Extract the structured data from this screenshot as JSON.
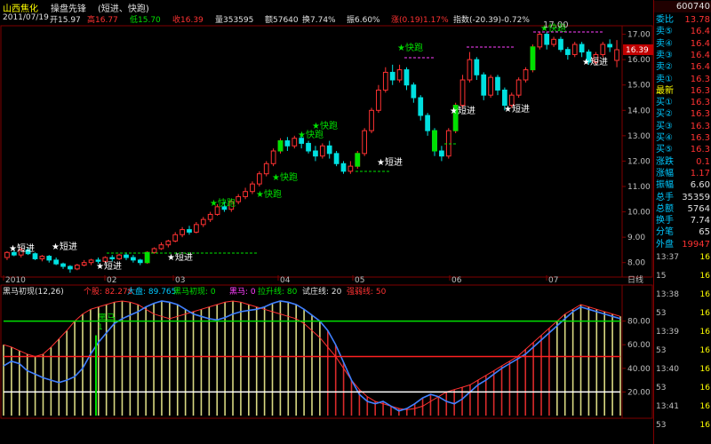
{
  "header": {
    "stock_name": "山西焦化",
    "indicator": "操盘先锋",
    "params": "(短进、快跑)",
    "code": "600740"
  },
  "info": {
    "date": "2011/07/19",
    "open_label": "开15.97",
    "high_label": "高16.77",
    "low_label": "低15.70",
    "close_label": "收16.39",
    "vol_label": "量353595",
    "amt_label": "额57640",
    "turn_label": "换7.74%",
    "amp_label": "振6.60%",
    "chg_label": "涨(0.19)1.17%",
    "index_label": "指数(-20.39)-0.72%"
  },
  "price_axis": [
    "17.00",
    "16.00",
    "15.00",
    "14.00",
    "13.00",
    "12.00",
    "11.00",
    "10.00",
    "9.00",
    "8.00"
  ],
  "price_marker": "16.39",
  "month_labels": [
    "2010",
    "02",
    "03",
    "04",
    "05",
    "06",
    "07"
  ],
  "period_label": "日线",
  "indicator_bar": {
    "name": "黑马初现(12,26)",
    "stock": "个股: 82.278",
    "market": "大盘: 89.765",
    "hm_first": "黑马初现: 0",
    "hm": "黑马: 0",
    "pull": "拉升线: 80",
    "test": "试庄线: 20",
    "strong": "强弱线: 50"
  },
  "ind_axis": [
    "80.00",
    "60.00",
    "40.00",
    "20.00"
  ],
  "ind_tag": "黑马\n1",
  "annotations": {
    "short_in": "短进",
    "quick_run": "快跑",
    "hi_label": "17.00",
    "top_price": "16.39"
  },
  "chart_data": {
    "type": "candlestick",
    "y_range": [
      7.5,
      17.3
    ],
    "ind_range": [
      0,
      100
    ],
    "candles": [
      [
        8.2,
        8.4,
        8.1,
        8.45
      ],
      [
        8.4,
        8.3,
        8.25,
        8.55
      ],
      [
        8.3,
        8.5,
        8.2,
        8.6
      ],
      [
        8.5,
        8.35,
        8.3,
        8.6
      ],
      [
        8.35,
        8.15,
        8.1,
        8.4
      ],
      [
        8.15,
        8.25,
        8.05,
        8.3
      ],
      [
        8.25,
        8.1,
        8.0,
        8.3
      ],
      [
        8.1,
        7.95,
        7.9,
        8.2
      ],
      [
        7.95,
        7.85,
        7.75,
        8.0
      ],
      [
        7.85,
        7.75,
        7.6,
        7.9
      ],
      [
        7.75,
        7.9,
        7.7,
        7.95
      ],
      [
        7.9,
        8.0,
        7.85,
        8.1
      ],
      [
        8.0,
        8.1,
        7.9,
        8.15
      ],
      [
        8.1,
        8.05,
        7.95,
        8.2
      ],
      [
        8.05,
        8.2,
        8.0,
        8.25
      ],
      [
        8.2,
        8.15,
        8.05,
        8.3
      ],
      [
        8.15,
        8.3,
        8.1,
        8.35
      ],
      [
        8.3,
        8.2,
        8.1,
        8.4
      ],
      [
        8.2,
        8.1,
        8.0,
        8.3
      ],
      [
        8.1,
        8.0,
        7.9,
        8.15
      ],
      [
        8.0,
        8.4,
        7.95,
        8.45
      ],
      [
        8.4,
        8.55,
        8.35,
        8.6
      ],
      [
        8.55,
        8.7,
        8.5,
        8.8
      ],
      [
        8.7,
        8.85,
        8.6,
        8.9
      ],
      [
        8.85,
        9.1,
        8.8,
        9.2
      ],
      [
        9.1,
        9.3,
        9.0,
        9.4
      ],
      [
        9.3,
        9.2,
        9.1,
        9.45
      ],
      [
        9.2,
        9.5,
        9.15,
        9.6
      ],
      [
        9.5,
        9.7,
        9.4,
        9.8
      ],
      [
        9.7,
        9.9,
        9.6,
        10.0
      ],
      [
        9.9,
        10.2,
        9.85,
        10.3
      ],
      [
        10.2,
        10.1,
        10.0,
        10.4
      ],
      [
        10.1,
        10.4,
        10.0,
        10.5
      ],
      [
        10.4,
        10.6,
        10.3,
        10.7
      ],
      [
        10.6,
        10.8,
        10.5,
        10.95
      ],
      [
        10.8,
        11.1,
        10.7,
        11.2
      ],
      [
        11.1,
        11.5,
        11.0,
        11.6
      ],
      [
        11.5,
        11.9,
        11.4,
        12.0
      ],
      [
        11.9,
        12.4,
        11.8,
        12.5
      ],
      [
        12.4,
        12.8,
        12.3,
        12.9
      ],
      [
        12.8,
        12.6,
        12.4,
        12.95
      ],
      [
        12.6,
        12.9,
        12.5,
        13.0
      ],
      [
        12.9,
        12.7,
        12.5,
        13.1
      ],
      [
        12.7,
        12.4,
        12.3,
        12.8
      ],
      [
        12.4,
        12.2,
        12.0,
        12.6
      ],
      [
        12.2,
        12.6,
        12.1,
        12.7
      ],
      [
        12.6,
        12.3,
        12.1,
        12.8
      ],
      [
        12.3,
        11.9,
        11.8,
        12.4
      ],
      [
        11.9,
        11.6,
        11.5,
        12.0
      ],
      [
        11.6,
        11.8,
        11.5,
        12.0
      ],
      [
        11.8,
        12.3,
        11.7,
        12.4
      ],
      [
        12.3,
        13.2,
        12.2,
        13.3
      ],
      [
        13.2,
        14.0,
        13.1,
        14.1
      ],
      [
        14.0,
        14.8,
        13.9,
        15.0
      ],
      [
        14.8,
        15.5,
        14.7,
        15.7
      ],
      [
        15.5,
        15.2,
        15.0,
        15.8
      ],
      [
        15.2,
        15.6,
        15.1,
        15.8
      ],
      [
        15.6,
        15.0,
        14.8,
        15.7
      ],
      [
        15.0,
        14.5,
        14.3,
        15.1
      ],
      [
        14.5,
        13.8,
        13.6,
        14.6
      ],
      [
        13.8,
        13.2,
        13.0,
        13.9
      ],
      [
        13.2,
        12.4,
        12.2,
        13.3
      ],
      [
        12.4,
        12.2,
        12.0,
        12.6
      ],
      [
        12.2,
        13.2,
        12.1,
        13.3
      ],
      [
        13.2,
        14.2,
        13.1,
        14.3
      ],
      [
        14.2,
        15.2,
        14.1,
        15.4
      ],
      [
        15.2,
        16.0,
        15.1,
        16.3
      ],
      [
        16.0,
        15.4,
        15.2,
        16.1
      ],
      [
        15.4,
        14.6,
        14.4,
        15.5
      ],
      [
        14.6,
        15.3,
        14.5,
        15.4
      ],
      [
        15.3,
        14.8,
        14.6,
        15.4
      ],
      [
        14.8,
        14.2,
        14.0,
        14.9
      ],
      [
        14.2,
        14.6,
        14.1,
        14.7
      ],
      [
        14.6,
        15.2,
        14.5,
        15.3
      ],
      [
        15.2,
        15.6,
        15.1,
        15.7
      ],
      [
        15.6,
        16.5,
        15.5,
        16.6
      ],
      [
        16.5,
        17.0,
        16.4,
        17.1
      ],
      [
        17.0,
        16.6,
        16.4,
        17.1
      ],
      [
        16.6,
        16.8,
        16.5,
        16.9
      ],
      [
        16.8,
        16.4,
        16.3,
        16.9
      ],
      [
        16.4,
        16.2,
        16.0,
        16.5
      ],
      [
        16.2,
        16.6,
        16.1,
        16.7
      ],
      [
        16.6,
        16.3,
        16.1,
        16.7
      ],
      [
        16.3,
        15.9,
        15.8,
        16.4
      ],
      [
        15.9,
        16.2,
        15.8,
        16.3
      ],
      [
        16.2,
        16.6,
        16.1,
        16.7
      ],
      [
        16.6,
        16.5,
        16.3,
        16.8
      ],
      [
        15.97,
        16.39,
        15.7,
        16.77
      ]
    ],
    "stock_line": [
      42,
      46,
      44,
      38,
      35,
      32,
      30,
      28,
      30,
      33,
      40,
      52,
      62,
      70,
      78,
      82,
      85,
      88,
      92,
      95,
      97,
      96,
      94,
      90,
      86,
      84,
      82,
      81,
      83,
      86,
      88,
      89,
      90,
      92,
      95,
      97,
      96,
      94,
      90,
      85,
      80,
      72,
      60,
      45,
      30,
      18,
      12,
      10,
      12,
      8,
      4,
      6,
      10,
      15,
      18,
      16,
      12,
      10,
      14,
      20,
      26,
      30,
      35,
      40,
      44,
      48,
      52,
      58,
      64,
      70,
      76,
      82,
      88,
      92,
      90,
      88,
      86,
      84,
      82
    ],
    "market_line": [
      60,
      58,
      55,
      52,
      50,
      52,
      58,
      65,
      72,
      80,
      86,
      90,
      92,
      94,
      96,
      97,
      96,
      94,
      90,
      86,
      84,
      82,
      84,
      86,
      88,
      90,
      92,
      94,
      96,
      97,
      96,
      94,
      92,
      90,
      88,
      86,
      84,
      82,
      78,
      72,
      66,
      58,
      50,
      40,
      30,
      22,
      16,
      12,
      10,
      8,
      6,
      5,
      6,
      8,
      12,
      16,
      20,
      22,
      24,
      26,
      30,
      34,
      38,
      42,
      46,
      50,
      56,
      62,
      68,
      74,
      80,
      86,
      90,
      94,
      92,
      90,
      88,
      86,
      84
    ],
    "pull_line": 80,
    "test_line": 20,
    "strong_line": 50
  }
}
